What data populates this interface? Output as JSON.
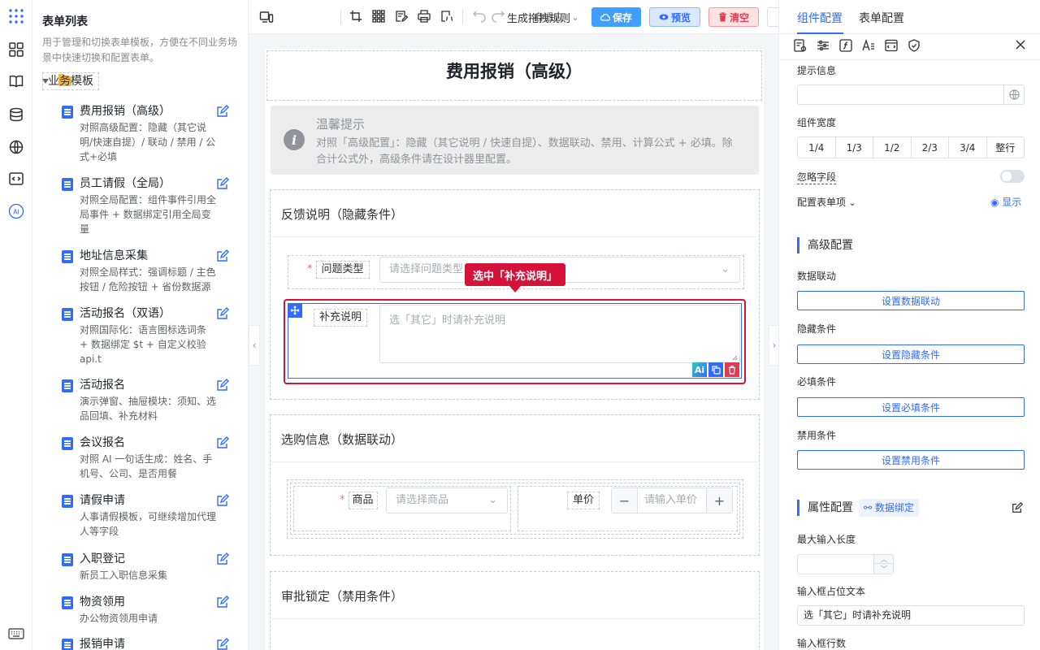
{
  "sidebar": {
    "title": "表单列表",
    "description": "用于管理和切换表单模板，方便在不同业务场景中快速切换和配置表单。",
    "group": "业务模板",
    "items": [
      {
        "title": "费用报销（高级）",
        "desc": "对照高级配置：隐藏（其它说明/快速自提）/ 联动 / 禁用 / 公式+必填"
      },
      {
        "title": "员工请假（全局）",
        "desc": "对照全局配置：组件事件引用全局事件 + 数据绑定引用全局变量"
      },
      {
        "title": "地址信息采集",
        "desc": "对照全局样式：强调标题 / 主色按钮 / 危险按钮 + 省份数据源"
      },
      {
        "title": "活动报名（双语）",
        "desc": "对照国际化：语言图标选词条 + 数据绑定 $t + 自定义校验 api.t"
      },
      {
        "title": "活动报名",
        "desc": "演示弹窗、抽屉模块：须知、选品回填、补充材料"
      },
      {
        "title": "会议报名",
        "desc": "对照 AI 一句话生成：姓名、手机号、公司、是否用餐"
      },
      {
        "title": "请假申请",
        "desc": "人事请假模板，可继续增加代理人等字段"
      },
      {
        "title": "入职登记",
        "desc": "新员工入职信息采集"
      },
      {
        "title": "物资领用",
        "desc": "办公物资领用申请"
      },
      {
        "title": "报销申请",
        "desc": ""
      }
    ]
  },
  "toolbar": {
    "adapt": "自适应",
    "gen_rule": "生成拖拽规则",
    "save": "保存",
    "preview": "预览",
    "clear": "清空"
  },
  "form": {
    "title": "费用报销（高级）",
    "tip_title": "温馨提示",
    "tip_body": "对照「高级配置」：隐藏（其它说明 / 快速自提）、数据联动、禁用、计算公式 + 必填。除合计公式外，高级条件请在设计器里配置。",
    "sec1": "反馈说明（隐藏条件）",
    "issue_label": "问题类型",
    "issue_placeholder": "请选择问题类型",
    "selected_badge": "选中「补充说明」",
    "supp_label": "补充说明",
    "supp_placeholder": "选「其它」时请补充说明",
    "sec2": "选购信息（数据联动）",
    "goods_label": "商品",
    "goods_placeholder": "请选择商品",
    "price_label": "单价",
    "price_placeholder": "请输入单价",
    "sec3": "审批锁定（禁用条件）",
    "ai_label": "Ai"
  },
  "panel": {
    "tab_component": "组件配置",
    "tab_form": "表单配置",
    "hint_label": "提示信息",
    "width_label": "组件宽度",
    "widths": [
      "1/4",
      "1/3",
      "1/2",
      "2/3",
      "3/4",
      "整行"
    ],
    "ignore_label": "忽略字段",
    "ignore_on": false,
    "single_label": "配置表单项",
    "show_link": "显示",
    "advanced": "高级配置",
    "linkage_label": "数据联动",
    "linkage_btn": "设置数据联动",
    "hide_label": "隐藏条件",
    "hide_btn": "设置隐藏条件",
    "required_label": "必填条件",
    "required_btn": "设置必填条件",
    "disable_label": "禁用条件",
    "disable_btn": "设置禁用条件",
    "prop": "属性配置",
    "binding": "数据绑定",
    "maxlen_label": "最大输入长度",
    "placeholder_label": "输入框占位文本",
    "placeholder_value": "选「其它」时请补充说明",
    "rows_label": "输入框行数"
  },
  "colors": {
    "primary": "#2f6bff",
    "danger": "#e03d55",
    "accent_red": "#d4123a"
  }
}
